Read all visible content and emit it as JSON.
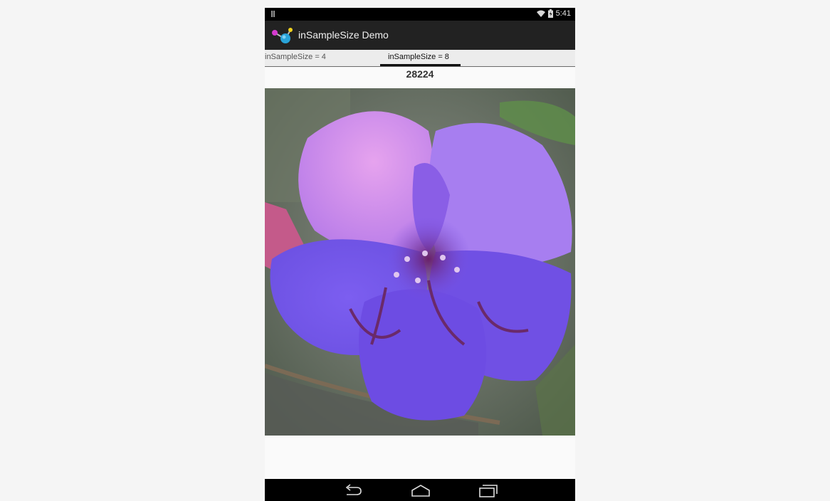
{
  "status_bar": {
    "time": "5:41",
    "icons": [
      "notification-icon",
      "wifi-icon",
      "battery-icon"
    ]
  },
  "action_bar": {
    "title": "inSampleSize Demo",
    "icon": "app-icon"
  },
  "tabs": [
    {
      "label": "inSampleSize = 4",
      "selected": false
    },
    {
      "label": "inSampleSize = 8",
      "selected": true
    }
  ],
  "content": {
    "byte_count": "28224",
    "image": "flower-photo"
  },
  "nav_bar": {
    "buttons": [
      "back-icon",
      "home-icon",
      "recents-icon"
    ]
  }
}
